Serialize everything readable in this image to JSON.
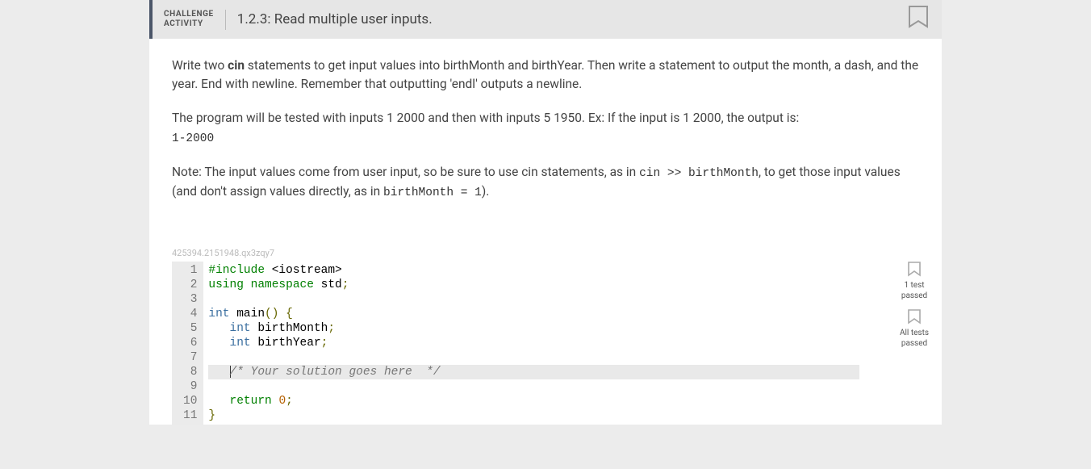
{
  "header": {
    "label_line1": "CHALLENGE",
    "label_line2": "ACTIVITY",
    "title": "1.2.3: Read multiple user inputs."
  },
  "instructions": {
    "para1_before_cin": "Write two ",
    "cin_bold": "cin",
    "para1_after_cin": " statements to get input values into birthMonth and birthYear. Then write a statement to output the month, a dash, and the year. End with newline. Remember that outputting 'endl' outputs a newline.",
    "para2": "The program will be tested with inputs 1 2000 and then with inputs 5 1950. Ex: If the input is 1 2000, the output is:",
    "example_output": "1-2000",
    "note_before_code1": "Note: The input values come from user input, so be sure to use cin statements, as in ",
    "code1": "cin >> birthMonth",
    "note_between": ", to get those input values (and don't assign values directly, as in ",
    "code2": "birthMonth = 1",
    "note_after": ")."
  },
  "watermark": "425394.2151948.qx3zqy7",
  "code": {
    "lines": [
      {
        "n": "1",
        "pre": "#include",
        "post": " <iostream>",
        "type": "preproc"
      },
      {
        "n": "2",
        "raw_using": "using ",
        "raw_ns": "namespace ",
        "raw_std": "std",
        "raw_semi": ";",
        "type": "using"
      },
      {
        "n": "3",
        "type": "blank"
      },
      {
        "n": "4",
        "raw_int": "int ",
        "raw_main": "main",
        "raw_paren": "() {",
        "type": "main"
      },
      {
        "n": "5",
        "indent": "   ",
        "raw_int": "int ",
        "raw_var": "birthMonth",
        "raw_semi": ";",
        "type": "decl"
      },
      {
        "n": "6",
        "indent": "   ",
        "raw_int": "int ",
        "raw_var": "birthYear",
        "raw_semi": ";",
        "type": "decl"
      },
      {
        "n": "7",
        "type": "blank"
      },
      {
        "n": "8",
        "indent": "   ",
        "comment": "/* Your solution goes here  */",
        "type": "placeholder"
      },
      {
        "n": "9",
        "type": "blank"
      },
      {
        "n": "10",
        "indent": "   ",
        "raw_ret": "return ",
        "raw_num": "0",
        "raw_semi": ";",
        "type": "return"
      },
      {
        "n": "11",
        "raw_close": "}",
        "type": "closebrace"
      }
    ]
  },
  "tests": {
    "one_test_l1": "1 test",
    "one_test_l2": "passed",
    "all_tests_l1": "All tests",
    "all_tests_l2": "passed"
  }
}
